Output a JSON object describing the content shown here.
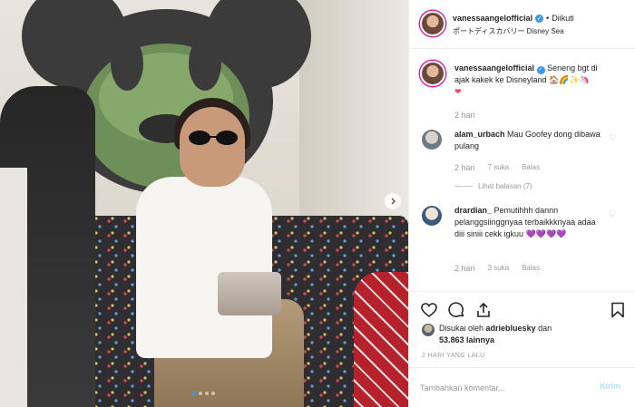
{
  "post": {
    "username": "vanessaangelofficial",
    "follow_status": "Diikuti",
    "separator": "•",
    "location": "ポートディスカバリー Disney Sea",
    "caption": "Seneng bgt di ajak kakek ke Disneyland",
    "caption_emoji": "🏠🌈✨🦄",
    "caption_heart": "❤",
    "caption_time": "2 hari"
  },
  "comments": [
    {
      "username": "alam_urbach",
      "text": "Mau Goofey dong dibawa pulang",
      "time": "2 hari",
      "likes": "7 suka",
      "reply": "Balas",
      "view_replies": "Lihat balasan (7)"
    },
    {
      "username": "drardian_",
      "text": "Pemutihhh dannn pelanggsiinggnyaa terbaikkknyaa adaa diii siniii cekk igkuu",
      "emoji": "💜💜💜💜",
      "time": "2 hari",
      "likes": "3 suka",
      "reply": "Balas"
    }
  ],
  "liked_by": {
    "prefix": "Disukai oleh",
    "user": "adriebluesky",
    "connector": "dan",
    "count": "53.863 lainnya"
  },
  "date_label": "2 HARI YANG LALU",
  "comment_box": {
    "placeholder": "Tambahkan komentar...",
    "post_label": "Kirim"
  },
  "icons": {
    "like": "heart-outline-icon",
    "comment": "comment-bubble-icon",
    "share": "share-icon",
    "save": "bookmark-icon",
    "next": "chevron-right-icon"
  },
  "colors": {
    "link_blue": "#3897f0",
    "verified": "#3897f0",
    "heart": "#ed4956",
    "muted": "#999999"
  },
  "carousel": {
    "current": 1,
    "total": 4
  }
}
